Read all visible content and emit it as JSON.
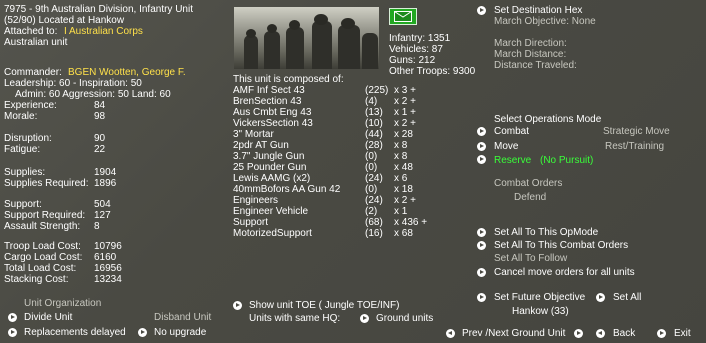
{
  "header": {
    "line1": "7975 - 9th Australian Division, Infantry Unit",
    "line2": "(52/90) Located at Hankow",
    "attached_label": "Attached to:",
    "attached_value": "I Australian Corps",
    "nationality": "Australian unit"
  },
  "commander": {
    "label": "Commander:",
    "name": "BGEN Wootten, George F.",
    "leadership": "Leadership: 60 - Inspiration: 50",
    "ratings": "Admin: 60  Aggression: 50 Land: 60"
  },
  "stats": [
    {
      "label": "Experience:",
      "value": "84"
    },
    {
      "label": "Morale:",
      "value": "98"
    },
    {
      "label": "Disruption:",
      "value": "90"
    },
    {
      "label": "Fatigue:",
      "value": "22"
    },
    {
      "label": "Supplies:",
      "value": "1904"
    },
    {
      "label": "Supplies Required:",
      "value": "1896"
    },
    {
      "label": "Support:",
      "value": "504"
    },
    {
      "label": "Support Required:",
      "value": "127"
    },
    {
      "label": "Assault Strength:",
      "value": "8"
    },
    {
      "label": "Troop Load Cost:",
      "value": "10796"
    },
    {
      "label": "Cargo Load Cost:",
      "value": "6160"
    },
    {
      "label": "Total Load Cost:",
      "value": "16956"
    },
    {
      "label": "Stacking Cost:",
      "value": "13234"
    }
  ],
  "organization": {
    "title": "Unit Organization",
    "divide": "Divide Unit",
    "disband": "Disband Unit",
    "replacements": "Replacements delayed",
    "upgrade": "No upgrade"
  },
  "strength": {
    "infantry": "Infantry: 1351",
    "vehicles": "Vehicles: 87",
    "guns": "Guns: 212",
    "other": "Other Troops: 9300"
  },
  "composition": {
    "title": "This unit is composed of:",
    "rows": [
      {
        "name": "AMF Inf Sect 43",
        "count": "(225)",
        "mult": "x 3 +"
      },
      {
        "name": "BrenSection 43",
        "count": "(4)",
        "mult": "x 2 +"
      },
      {
        "name": "Aus Cmbt Eng 43",
        "count": "(13)",
        "mult": "x 1 +"
      },
      {
        "name": "VickersSection 43",
        "count": "(10)",
        "mult": "x 2 +"
      },
      {
        "name": "3\" Mortar",
        "count": "(44)",
        "mult": "x 28"
      },
      {
        "name": "2pdr AT Gun",
        "count": "(28)",
        "mult": "x 8"
      },
      {
        "name": "3.7\" Jungle Gun",
        "count": "(0)",
        "mult": "x 8"
      },
      {
        "name": "25 Pounder Gun",
        "count": "(0)",
        "mult": "x 48"
      },
      {
        "name": "Lewis AAMG (x2)",
        "count": "(24)",
        "mult": "x 6"
      },
      {
        "name": "40mmBofors AA Gun  42",
        "count": "(0)",
        "mult": "x 18"
      },
      {
        "name": "Engineers",
        "count": "(24)",
        "mult": "x 2 +"
      },
      {
        "name": "Engineer Vehicle",
        "count": "(2)",
        "mult": "x 1"
      },
      {
        "name": "Support",
        "count": "(68)",
        "mult": "x 436 +"
      },
      {
        "name": "MotorizedSupport",
        "count": "(16)",
        "mult": "x 68"
      }
    ]
  },
  "toe": {
    "show": "Show unit TOE ( Jungle TOE/INF)",
    "same_hq_label": "Units with same HQ:",
    "ground": "Ground units"
  },
  "destination": {
    "set": "Set Destination Hex",
    "march_objective": "March Objective: None",
    "march_direction": "March Direction:",
    "march_distance": "March Distance:",
    "distance_traveled": "Distance Traveled:"
  },
  "ops": {
    "title": "Select Operations Mode",
    "combat": "Combat",
    "strategic": "Strategic Move",
    "move": "Move",
    "rest": "Rest/Training",
    "reserve": "Reserve",
    "no_pursuit": "(No Pursuit)",
    "combat_orders": "Combat Orders",
    "defend": "Defend"
  },
  "actions": {
    "set_all_opmode": "Set All To This OpMode",
    "set_all_combat": "Set All To This Combat Orders",
    "set_all_follow": "Set All To Follow",
    "cancel_move": "Cancel move orders for all units",
    "future_objective": "Set Future Objective",
    "set_all": "Set All",
    "objective_value": "Hankow (33)"
  },
  "footer": {
    "prev_next": "Prev /Next Ground Unit",
    "back": "Back",
    "exit": "Exit"
  },
  "colors": {
    "background": "#4a4a43",
    "highlight_yellow": "#ffe14a",
    "reserve_green": "#39ff39",
    "dim_text": "#c7c7bf"
  }
}
